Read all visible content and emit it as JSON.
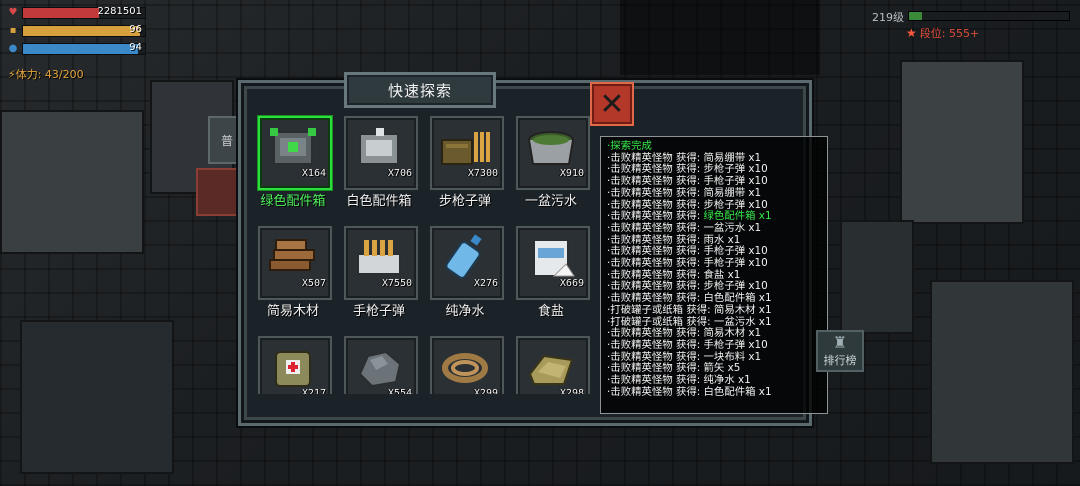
{
  "hud": {
    "hp": {
      "value": "2281501",
      "color": "#c23b3b",
      "fill": 0.62
    },
    "food": {
      "value": "96",
      "color": "#d6a13c",
      "fill": 0.96
    },
    "water": {
      "value": "94",
      "color": "#3c89c9",
      "fill": 0.94
    },
    "stamina_label": "体力: 43/200",
    "level": "219级",
    "level_fill": 0.08,
    "rank_label": "段位: 555+"
  },
  "panel": {
    "title": "快速探索",
    "close_label": "✕"
  },
  "items": [
    {
      "name": "绿色配件箱",
      "count": "X164",
      "icon": "green-parts-box-icon",
      "selected": true
    },
    {
      "name": "白色配件箱",
      "count": "X706",
      "icon": "white-parts-box-icon",
      "selected": false
    },
    {
      "name": "步枪子弹",
      "count": "X7300",
      "icon": "rifle-ammo-icon",
      "selected": false
    },
    {
      "name": "一盆污水",
      "count": "X910",
      "icon": "dirty-water-basin-icon",
      "selected": false
    },
    {
      "name": "简易木材",
      "count": "X507",
      "icon": "wood-logs-icon",
      "selected": false
    },
    {
      "name": "手枪子弹",
      "count": "X7550",
      "icon": "pistol-ammo-icon",
      "selected": false
    },
    {
      "name": "纯净水",
      "count": "X276",
      "icon": "water-bottle-icon",
      "selected": false
    },
    {
      "name": "食盐",
      "count": "X669",
      "icon": "salt-bag-icon",
      "selected": false
    },
    {
      "name": "",
      "count": "X217",
      "icon": "first-aid-backpack-icon",
      "selected": false
    },
    {
      "name": "",
      "count": "X554",
      "icon": "stone-icon",
      "selected": false
    },
    {
      "name": "",
      "count": "X299",
      "icon": "rope-icon",
      "selected": false
    },
    {
      "name": "",
      "count": "X298",
      "icon": "cloth-icon",
      "selected": false
    }
  ],
  "log": {
    "lines": [
      {
        "text": "·探索完成",
        "green": true
      },
      {
        "text": "·击败精英怪物 获得: 简易绷带 x1"
      },
      {
        "text": "·击败精英怪物 获得: 步枪子弹 x10"
      },
      {
        "text": "·击败精英怪物 获得: 手枪子弹 x10"
      },
      {
        "text": "·击败精英怪物 获得: 简易绷带 x1"
      },
      {
        "text": "·击败精英怪物 获得: 步枪子弹 x10"
      },
      {
        "prefix": "·击败精英怪物 获得: ",
        "highlight": "绿色配件箱 x1"
      },
      {
        "text": "·击败精英怪物 获得: 一盆污水 x1"
      },
      {
        "text": "·击败精英怪物 获得: 雨水 x1"
      },
      {
        "text": "·击败精英怪物 获得: 手枪子弹 x10"
      },
      {
        "text": "·击败精英怪物 获得: 手枪子弹 x10"
      },
      {
        "text": "·击败精英怪物 获得: 食盐 x1"
      },
      {
        "text": "·击败精英怪物 获得: 步枪子弹 x10"
      },
      {
        "text": "·击败精英怪物 获得: 白色配件箱 x1"
      },
      {
        "text": "·打破罐子或纸箱 获得: 简易木材 x1"
      },
      {
        "text": "·打破罐子或纸箱 获得: 一盆污水 x1"
      },
      {
        "text": "·击败精英怪物 获得: 简易木材 x1"
      },
      {
        "text": "·击败精英怪物 获得: 手枪子弹 x10"
      },
      {
        "text": "·击败精英怪物 获得: 一块布料 x1"
      },
      {
        "text": "·击败精英怪物 获得: 箭矢 x5"
      },
      {
        "text": "·击败精英怪物 获得: 纯净水 x1"
      },
      {
        "text": "·击败精英怪物 获得: 白色配件箱 x1"
      }
    ]
  },
  "side": {
    "rank_button_label": "排行榜",
    "left_btn_label": "普"
  }
}
